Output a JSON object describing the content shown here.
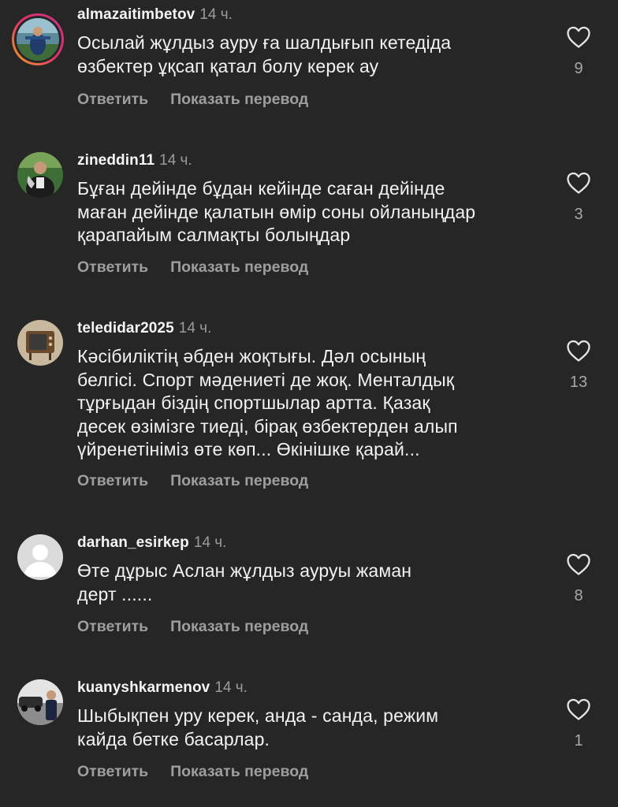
{
  "comments": [
    {
      "username": "almazaitimbetov",
      "time": "14 ч.",
      "lines": [
        "Осылай жұлдыз ауру ға шалдығып кетедіда",
        "өзбектер ұқсап қатал болу керек ау"
      ],
      "like_count": "9",
      "reply_label": "Ответить",
      "translate_label": "Показать перевод"
    },
    {
      "username": "zineddin11",
      "time": "14 ч.",
      "lines": [
        "Бұған дейінде бұдан кейінде саған дейінде",
        "маған дейінде қалатын өмір соны ойланыңдар",
        "қарапайым салмақты болыңдар"
      ],
      "like_count": "3",
      "reply_label": "Ответить",
      "translate_label": "Показать перевод"
    },
    {
      "username": "teledidar2025",
      "time": "14 ч.",
      "lines": [
        "Кәсібиліктің әбден жоқтығы. Дәл осының",
        "белгісі. Спорт мәдениеті де жоқ. Менталдық",
        "тұрғыдан біздің спортшылар артта. Қазақ",
        "десек өзімізге тиеді, бірақ өзбектерден алып",
        "үйренетініміз өте көп... Өкінішке қарай..."
      ],
      "like_count": "13",
      "reply_label": "Ответить",
      "translate_label": "Показать перевод"
    },
    {
      "username": "darhan_esirkep",
      "time": "14 ч.",
      "lines": [
        "Өте дұрыс Аслан жұлдыз ауруы жаман",
        "дерт ......"
      ],
      "like_count": "8",
      "reply_label": "Ответить",
      "translate_label": "Показать перевод"
    },
    {
      "username": "kuanyshkarmenov",
      "time": "14 ч.",
      "lines": [
        "Шыбықпен уру керек, анда - санда, режим",
        "кайда бетке басарлар."
      ],
      "like_count": "1",
      "reply_label": "Ответить",
      "translate_label": "Показать перевод"
    }
  ],
  "icons": {
    "like": "heart-outline-icon",
    "avatar_default": "default-avatar-icon"
  },
  "colors": {
    "background": "#262626",
    "primary_text": "#f5f5f5",
    "secondary_text": "#9e9e9e",
    "story_ring_start": "#f58529",
    "story_ring_end": "#dd2a7b"
  }
}
